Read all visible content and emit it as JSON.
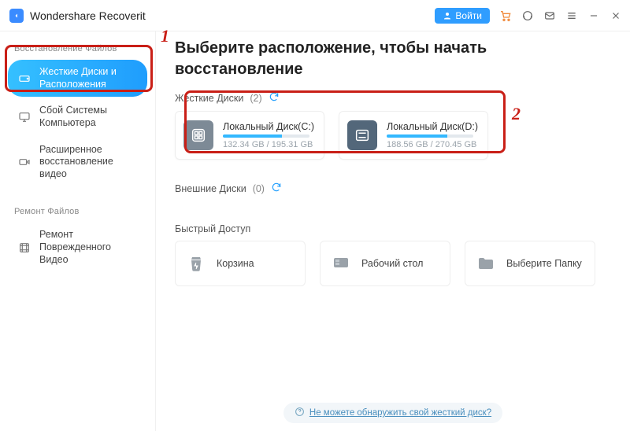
{
  "app": {
    "title": "Wondershare Recoverit",
    "login": "Войти"
  },
  "sidebar": {
    "section1": "Восстановление Файлов",
    "section2": "Ремонт Файлов",
    "items": [
      {
        "label": "Жесткие Диски и Расположения"
      },
      {
        "label": "Сбой Системы Компьютера"
      },
      {
        "label": "Расширенное восстановление видео"
      },
      {
        "label": "Ремонт Поврежденного Видео"
      }
    ]
  },
  "heading": "Выберите расположение, чтобы начать восстановление",
  "sections": {
    "hard": {
      "label": "Жесткие Диски",
      "count": "(2)"
    },
    "ext": {
      "label": "Внешние Диски",
      "count": "(0)"
    },
    "quick": {
      "label": "Быстрый Доступ"
    }
  },
  "disks": [
    {
      "name": "Локальный Диск(C:)",
      "size": "132.34 GB / 195.31 GB",
      "fill": "68%"
    },
    {
      "name": "Локальный Диск(D:)",
      "size": "188.56 GB / 270.45 GB",
      "fill": "70%"
    }
  ],
  "quick": [
    {
      "label": "Корзина"
    },
    {
      "label": "Рабочий стол"
    },
    {
      "label": "Выберите Папку"
    }
  ],
  "help": {
    "text": "Не можете обнаружить свой жесткий диск?"
  },
  "annotations": {
    "a1": "1",
    "a2": "2"
  }
}
